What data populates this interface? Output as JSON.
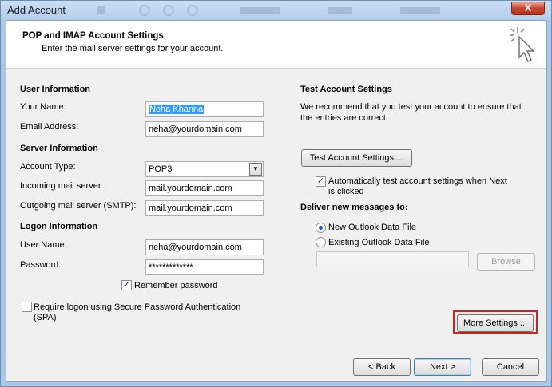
{
  "window": {
    "title": "Add Account",
    "close_label": "X"
  },
  "header": {
    "title": "POP and IMAP Account Settings",
    "subtitle": "Enter the mail server settings for your account."
  },
  "user_info": {
    "heading": "User Information",
    "your_name_label": "Your Name:",
    "your_name_value": "Neha Khanna",
    "email_label": "Email Address:",
    "email_value": "neha@yourdomain.com"
  },
  "server_info": {
    "heading": "Server Information",
    "account_type_label": "Account Type:",
    "account_type_value": "POP3",
    "incoming_label": "Incoming mail server:",
    "incoming_value": "mail.yourdomain.com",
    "outgoing_label": "Outgoing mail server (SMTP):",
    "outgoing_value": "mail.yourdomain.com"
  },
  "logon_info": {
    "heading": "Logon Information",
    "username_label": "User Name:",
    "username_value": "neha@yourdomain.com",
    "password_label": "Password:",
    "password_value": "*************",
    "remember_label": "Remember password",
    "remember_checked": true,
    "spa_label_line1": "Require logon using Secure Password Authentication",
    "spa_label_line2": "(SPA)",
    "spa_checked": false
  },
  "test_settings": {
    "heading": "Test Account Settings",
    "description_line1": "We recommend that you test your account to ensure that",
    "description_line2": "the entries are correct.",
    "test_button": "Test Account Settings ...",
    "auto_test_line1": "Automatically test account settings when Next",
    "auto_test_line2": "is clicked",
    "auto_test_checked": true
  },
  "deliver": {
    "heading": "Deliver new messages to:",
    "new_file_label": "New Outlook Data File",
    "existing_file_label": "Existing Outlook Data File",
    "selected": "new",
    "browse_button": "Browse"
  },
  "buttons": {
    "more_settings": "More Settings ...",
    "back": "< Back",
    "next": "Next >",
    "cancel": "Cancel"
  },
  "colors": {
    "highlight": "#d21f1f",
    "selection": "#3399ff"
  }
}
